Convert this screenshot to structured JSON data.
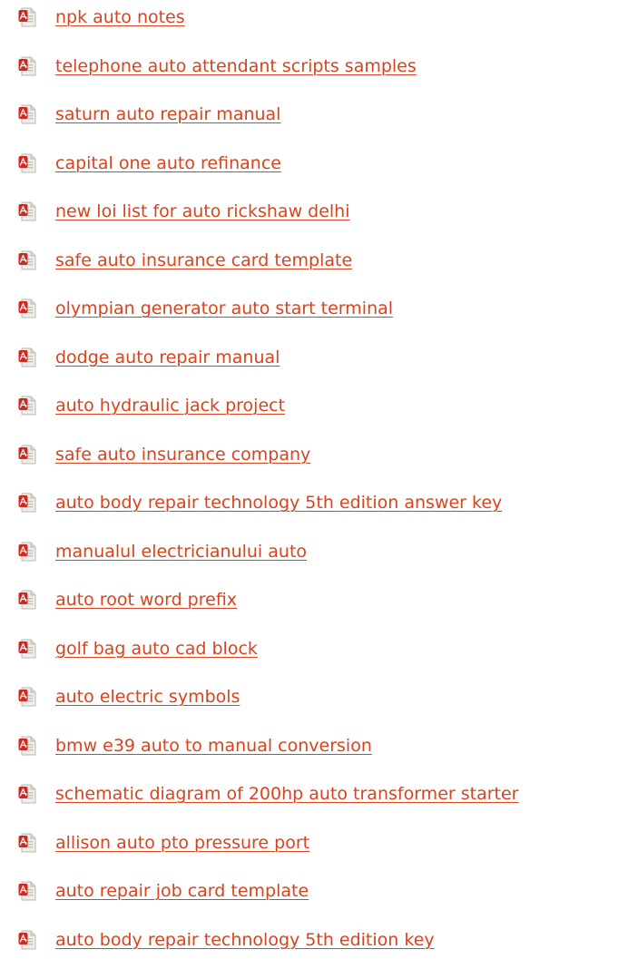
{
  "icon": "pdf-file-icon",
  "colors": {
    "link": "#d9431d",
    "icon_red": "#d7261e",
    "icon_paper": "#eeeeea"
  },
  "links": [
    "npk auto notes",
    "telephone auto attendant scripts samples",
    "saturn auto repair manual",
    "capital one auto refinance",
    "new loi list for auto rickshaw delhi",
    "safe auto insurance card template",
    "olympian generator auto start terminal",
    "dodge auto repair manual",
    "auto hydraulic jack project",
    "safe auto insurance company",
    "auto body repair technology 5th edition answer key",
    "manualul electricianului auto",
    "auto root word prefix",
    "golf bag auto cad block",
    "auto electric symbols",
    "bmw e39 auto to manual conversion",
    "schematic diagram of 200hp auto transformer starter",
    "allison auto pto pressure port",
    "auto repair job card template",
    "auto body repair technology 5th edition key"
  ]
}
